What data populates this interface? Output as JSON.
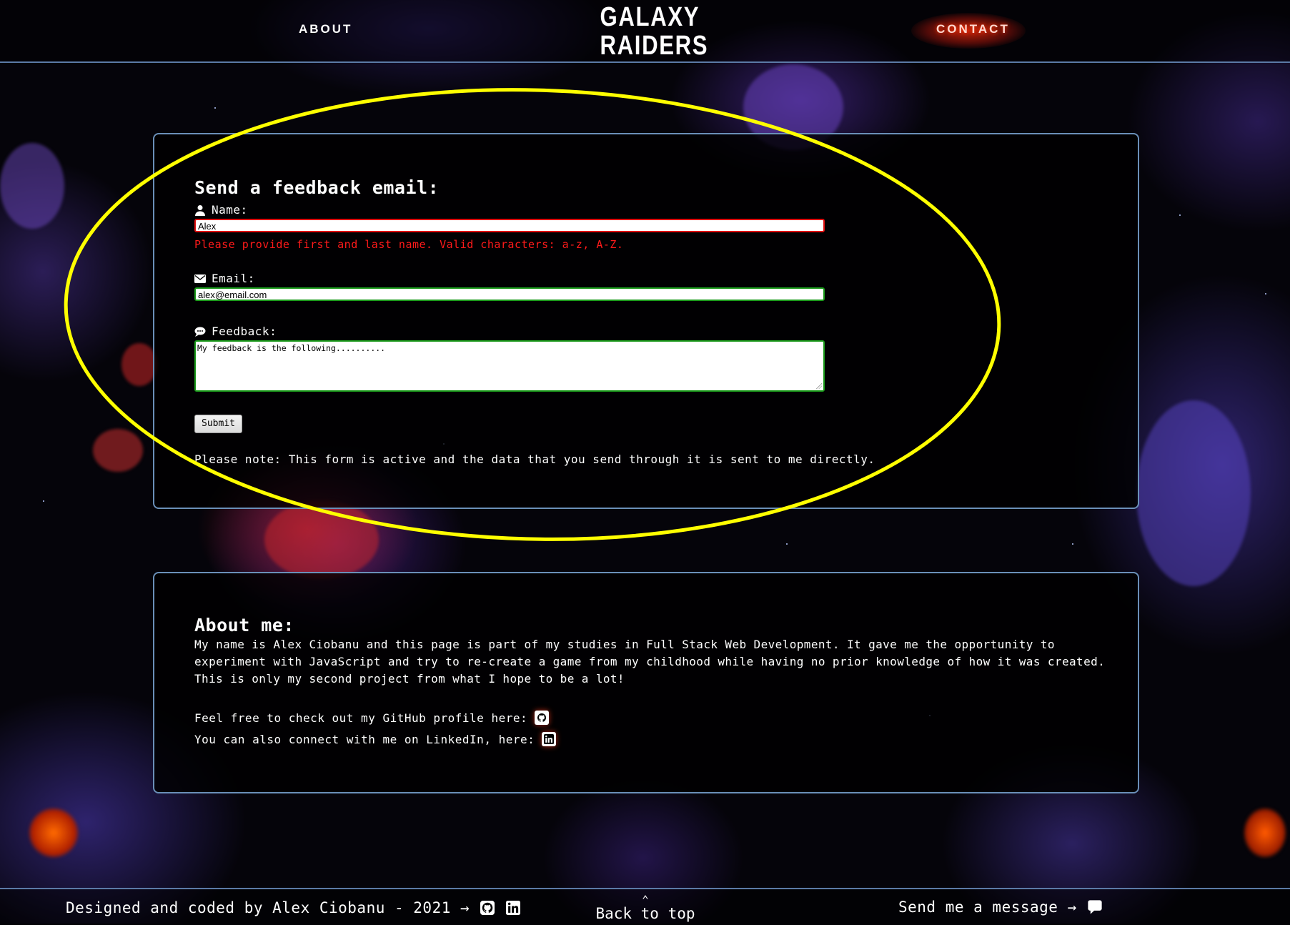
{
  "header": {
    "nav_about": "ABOUT",
    "logo_line1": "GALAXY",
    "logo_line2": "RAIDERS",
    "nav_contact": "CONTACT"
  },
  "form": {
    "title": "Send a feedback email:",
    "name_label": "Name:",
    "name_value": "Alex",
    "name_error": "Please provide first and last name. Valid characters: a-z, A-Z.",
    "email_label": "Email:",
    "email_value": "alex@email.com",
    "feedback_label": "Feedback:",
    "feedback_value": "My feedback is the following..........",
    "submit_label": "Submit",
    "note": "Please note: This form is active and the data that you send through it is sent to me directly."
  },
  "about": {
    "title": "About me:",
    "paragraph": "My name is Alex Ciobanu and this page is part of my studies in Full Stack Web Development. It gave me the opportunity to experiment with JavaScript and try to re-create a game from my childhood while having no prior knowledge of how it was created. This is only my second project from what I hope to be a lot!",
    "github_text": "Feel free to check out my GitHub profile here:",
    "linkedin_text": "You can also connect with me on LinkedIn, here:"
  },
  "footer": {
    "credit": "Designed and coded by Alex Ciobanu - 2021 →",
    "back_to_top": "Back to top",
    "send_message": "Send me a message →"
  },
  "colors": {
    "annotation": "#ffff00",
    "panel_border": "#6a8fb8",
    "error": "#ff1a1a",
    "valid_border": "#1a9a1a",
    "invalid_border": "#e01010"
  },
  "icons": [
    "user-icon",
    "envelope-icon",
    "comment-icon",
    "github-icon",
    "linkedin-icon",
    "chevron-up-icon",
    "message-icon"
  ]
}
